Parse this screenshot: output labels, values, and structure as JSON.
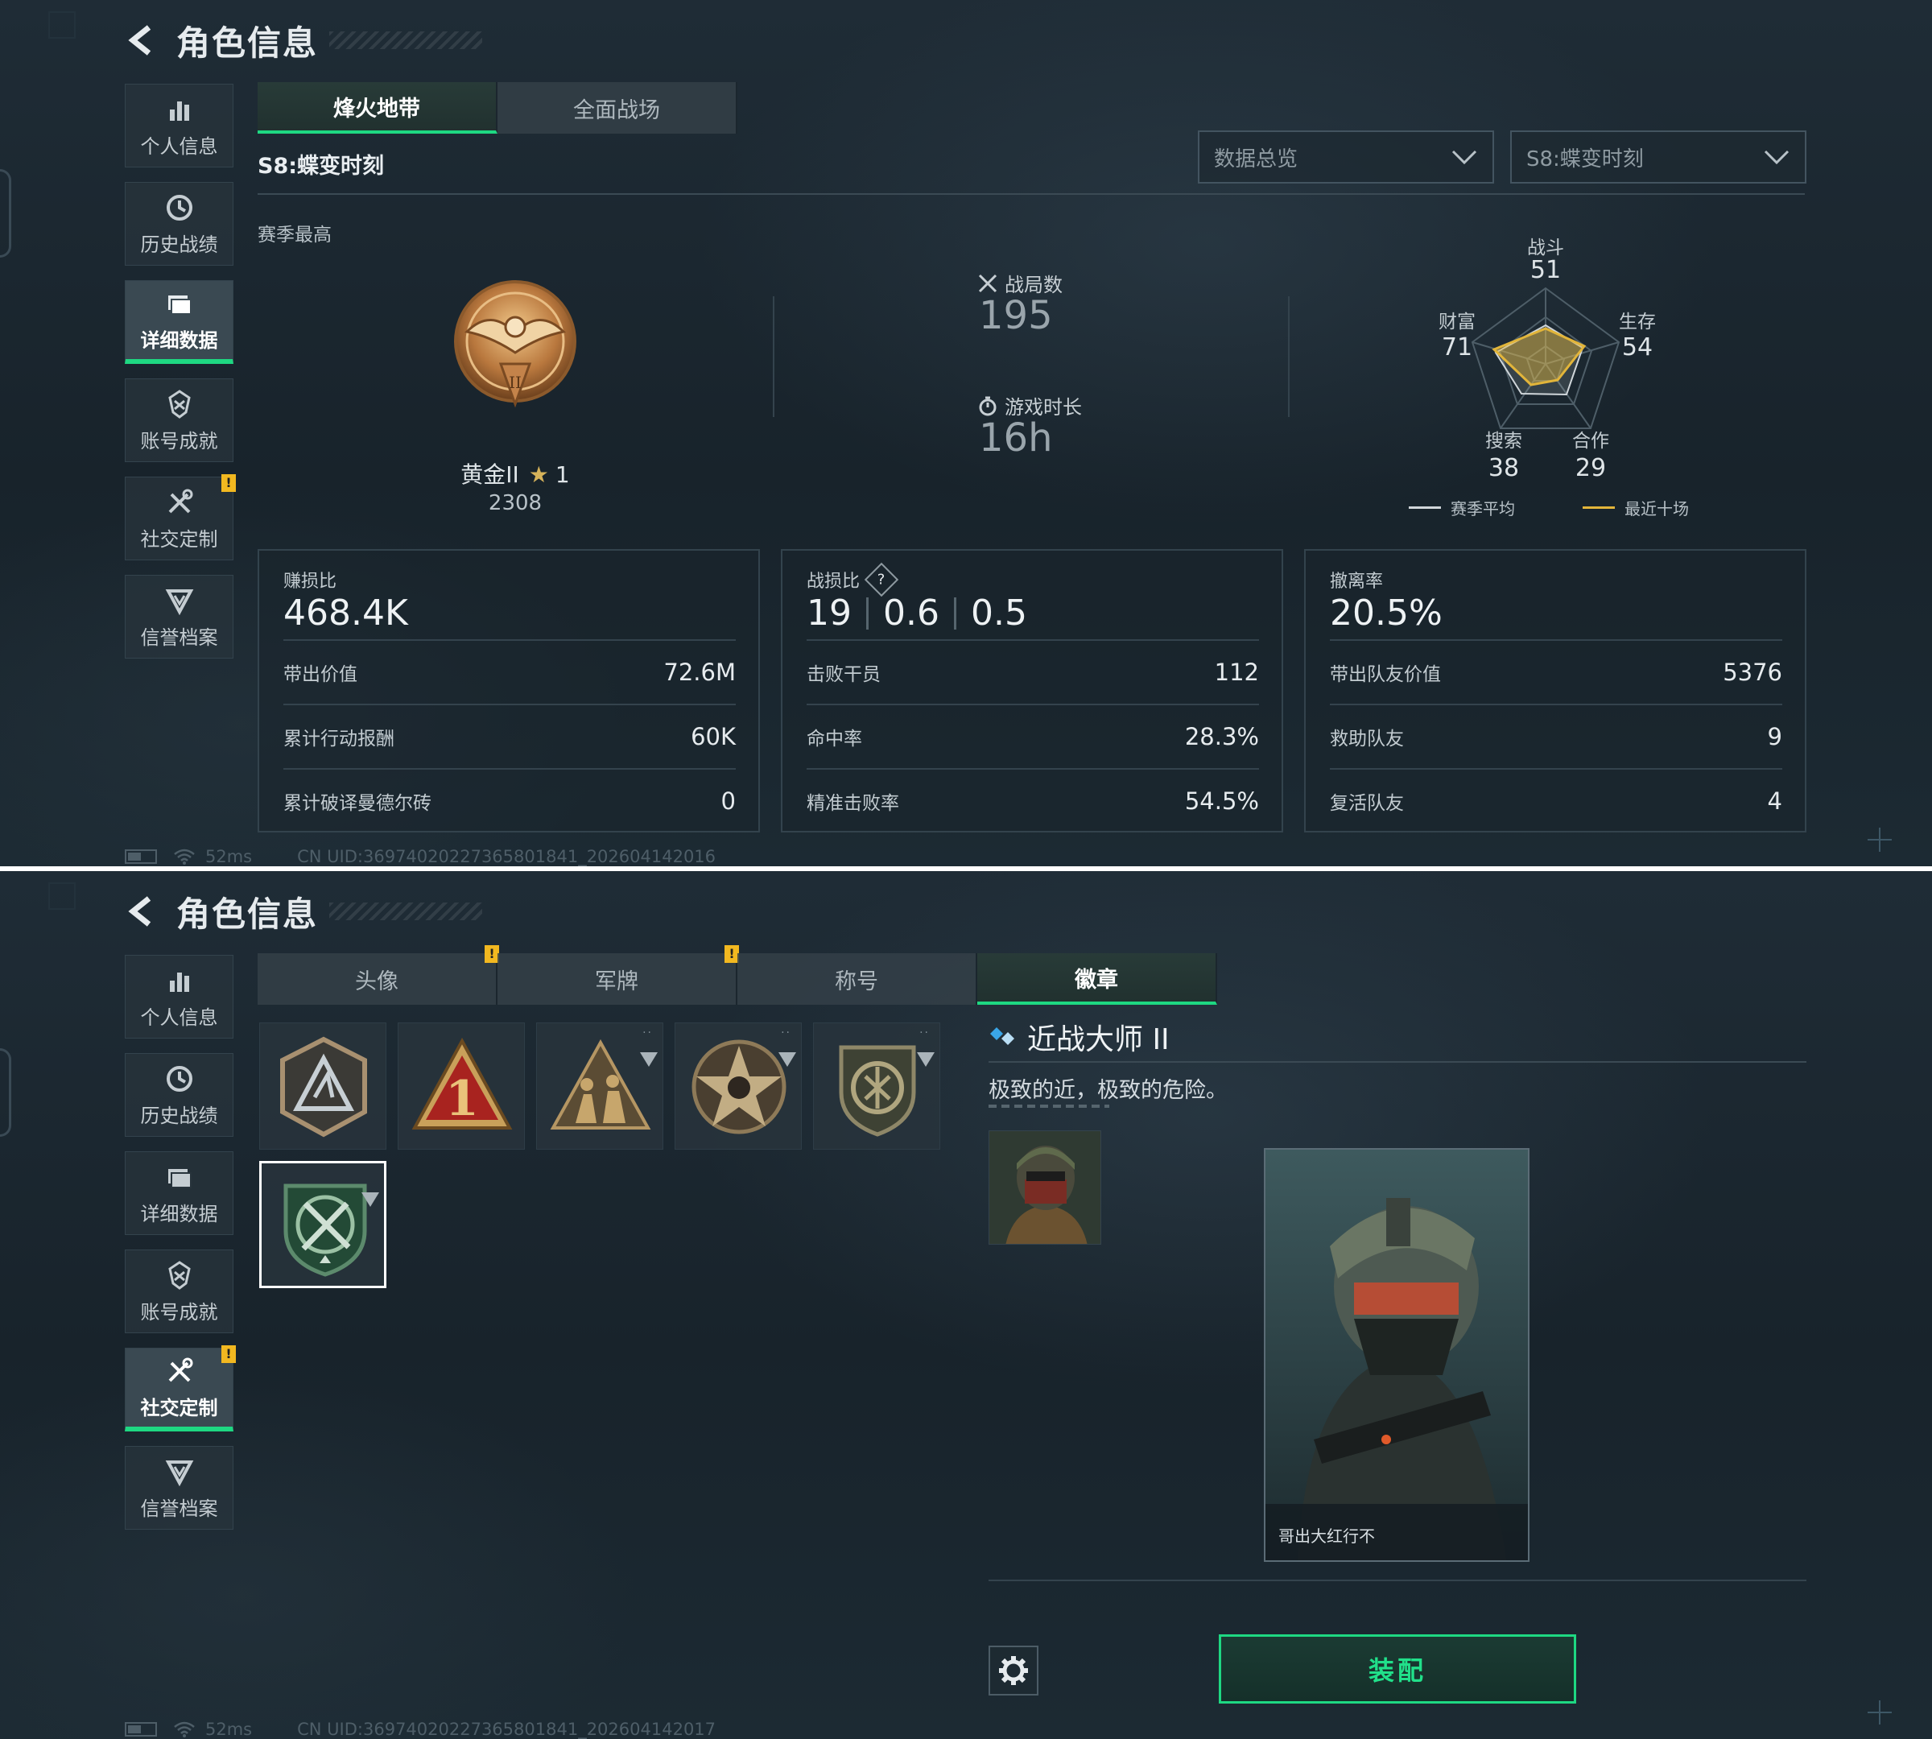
{
  "panel1": {
    "title": "角色信息",
    "sidebar": [
      {
        "label": "个人信息",
        "icon": "bar-chart-icon",
        "active": false
      },
      {
        "label": "历史战绩",
        "icon": "clock-icon",
        "active": false
      },
      {
        "label": "详细数据",
        "icon": "folder-icon",
        "active": true
      },
      {
        "label": "账号成就",
        "icon": "achievement-icon",
        "active": false
      },
      {
        "label": "社交定制",
        "icon": "tools-icon",
        "active": false,
        "badge": "!"
      },
      {
        "label": "信誉档案",
        "icon": "shield-icon",
        "active": false
      }
    ],
    "tabs": [
      {
        "label": "烽火地带",
        "active": true
      },
      {
        "label": "全面战场",
        "active": false
      }
    ],
    "season_label": "S8:蝶变时刻",
    "dropdowns": {
      "view": "数据总览",
      "season": "S8:蝶变时刻"
    },
    "season_best": "赛季最高",
    "rank": {
      "tier": "黄金II",
      "stars": "1",
      "score": "2308",
      "medal_icon": "gold-eagle-medal-icon"
    },
    "matches": {
      "label": "战局数",
      "value": "195"
    },
    "playtime": {
      "label": "游戏时长",
      "value": "16h"
    },
    "radar": {
      "axes": [
        {
          "label": "战斗",
          "value": "51"
        },
        {
          "label": "生存",
          "value": "54"
        },
        {
          "label": "合作",
          "value": "29"
        },
        {
          "label": "搜索",
          "value": "38"
        },
        {
          "label": "财富",
          "value": "71"
        }
      ],
      "legend": [
        {
          "label": "赛季平均",
          "color": "#d0d6da"
        },
        {
          "label": "最近十场",
          "color": "#e2b53a"
        }
      ]
    },
    "cards": [
      {
        "title": "赚损比",
        "main": [
          "468.4K"
        ],
        "rows": [
          {
            "label": "带出价值",
            "value": "72.6M"
          },
          {
            "label": "累计行动报酬",
            "value": "60K"
          },
          {
            "label": "累计破译曼德尔砖",
            "value": "0"
          }
        ]
      },
      {
        "title": "战损比",
        "help": "?",
        "main": [
          "19",
          "0.6",
          "0.5"
        ],
        "rows": [
          {
            "label": "击败干员",
            "value": "112"
          },
          {
            "label": "命中率",
            "value": "28.3%"
          },
          {
            "label": "精准击败率",
            "value": "54.5%"
          }
        ]
      },
      {
        "title": "撤离率",
        "main": [
          "20.5%"
        ],
        "rows": [
          {
            "label": "带出队友价值",
            "value": "5376"
          },
          {
            "label": "救助队友",
            "value": "9"
          },
          {
            "label": "复活队友",
            "value": "4"
          }
        ]
      }
    ],
    "status": {
      "ping": "52ms",
      "uid": "CN UID:369740202273658​01841_202604142016"
    }
  },
  "panel2": {
    "title": "角色信息",
    "sidebar": [
      {
        "label": "个人信息",
        "icon": "bar-chart-icon",
        "active": false
      },
      {
        "label": "历史战绩",
        "icon": "clock-icon",
        "active": false
      },
      {
        "label": "详细数据",
        "icon": "folder-icon",
        "active": false
      },
      {
        "label": "账号成就",
        "icon": "achievement-icon",
        "active": false
      },
      {
        "label": "社交定制",
        "icon": "tools-icon",
        "active": true,
        "badge": "!"
      },
      {
        "label": "信誉档案",
        "icon": "shield-icon",
        "active": false
      }
    ],
    "tabs": [
      {
        "label": "头像",
        "active": false,
        "badge": "!"
      },
      {
        "label": "军牌",
        "active": false,
        "badge": "!"
      },
      {
        "label": "称号",
        "active": false
      },
      {
        "label": "徽章",
        "active": true
      }
    ],
    "badges": [
      {
        "icon": "hex-shield-badge-icon",
        "selected": false
      },
      {
        "icon": "red-triangle-one-badge-icon",
        "selected": false
      },
      {
        "icon": "soldiers-triangle-badge-icon",
        "selected": false
      },
      {
        "icon": "star-skull-badge-icon",
        "selected": false
      },
      {
        "icon": "bronze-shield-badge-icon",
        "selected": false
      },
      {
        "icon": "green-crossed-knives-badge-icon",
        "selected": true
      }
    ],
    "detail": {
      "name": "近战大师 II",
      "description": "极致的近，极致的危险。",
      "card_name": "哥出大红行不"
    },
    "equip_label": "装配",
    "status": {
      "ping": "52ms",
      "uid": "CN UID:369740202273658​01841_202604142017"
    }
  }
}
